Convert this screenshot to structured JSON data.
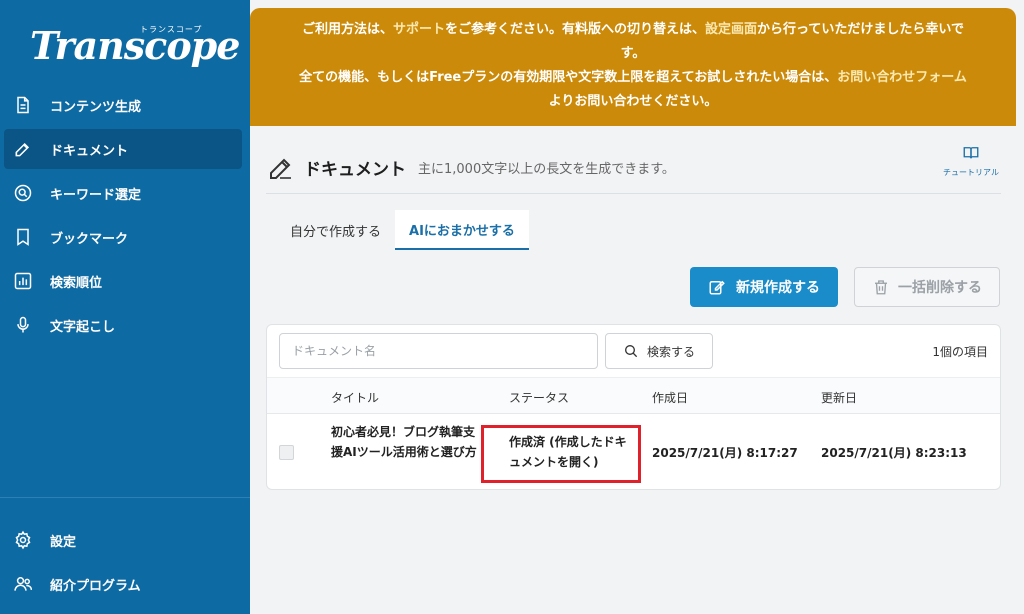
{
  "brand": {
    "name": "Transcope",
    "kana": "トランスコープ"
  },
  "sidebar": {
    "items": [
      {
        "label": "コンテンツ生成",
        "icon": "document-icon"
      },
      {
        "label": "ドキュメント",
        "icon": "edit-icon",
        "active": true
      },
      {
        "label": "キーワード選定",
        "icon": "search-circle-icon"
      },
      {
        "label": "ブックマーク",
        "icon": "bookmark-icon"
      },
      {
        "label": "検索順位",
        "icon": "bar-chart-icon"
      },
      {
        "label": "文字起こし",
        "icon": "microphone-icon"
      }
    ],
    "bottom_items": [
      {
        "label": "設定",
        "icon": "gear-icon"
      },
      {
        "label": "紹介プログラム",
        "icon": "users-icon"
      }
    ]
  },
  "banner": {
    "l1_a": "ご利用方法は、",
    "l1_link1": "サポート",
    "l1_b": "をご参考ください。有料版への切り替えは、",
    "l1_link2": "設定画面",
    "l1_c": "から行っていただけましたら幸いで",
    "l2": "す。",
    "l3_a": "全ての機能、もしくはFreeプランの有効期限や文字数上限を超えてお試しされたい場合は、",
    "l3_link": "お問い合わせフォーム",
    "l4": "よりお問い合わせください。"
  },
  "page": {
    "title": "ドキュメント",
    "description": "主に1,000文字以上の長文を生成できます。",
    "tutorial_label": "チュートリアル"
  },
  "tabs": [
    {
      "label": "自分で作成する",
      "active": false
    },
    {
      "label": "AIにおまかせする",
      "active": true
    }
  ],
  "actions": {
    "new_label": "新規作成する",
    "delete_label": "一括削除する"
  },
  "search": {
    "placeholder": "ドキュメント名",
    "button_label": "検索する",
    "count": "1個の項目"
  },
  "table": {
    "columns": [
      "タイトル",
      "ステータス",
      "作成日",
      "更新日"
    ],
    "rows": [
      {
        "title": "初心者必見！ブログ執筆支援AIツール活用術と選び方",
        "status": "作成済 (作成したドキュメントを開く)",
        "created": "2025/7/21(月) 8:17:27",
        "updated": "2025/7/21(月) 8:23:13"
      }
    ]
  },
  "colors": {
    "sidebar": "#0e6aa3",
    "banner": "#cc8a0a",
    "accent": "#1a8cc9",
    "highlight": "#e0202a"
  }
}
